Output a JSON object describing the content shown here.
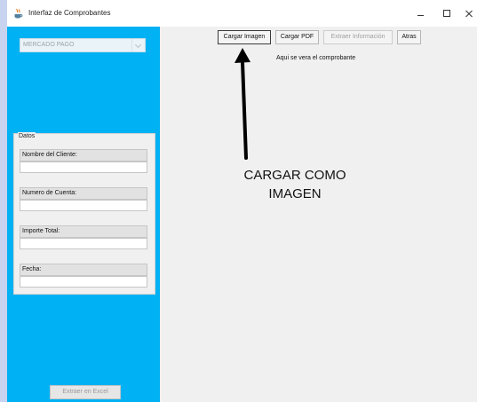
{
  "window": {
    "title": "Interfaz de Comprobantes",
    "controls": [
      "minimize",
      "maximize",
      "close"
    ]
  },
  "sidebar": {
    "provider_select": {
      "value": "MERCADO PAGO"
    },
    "datos": {
      "legend": "Datos",
      "fields": [
        {
          "label": "Nombre del Cliente:",
          "value": ""
        },
        {
          "label": "Numero de Cuenta:",
          "value": ""
        },
        {
          "label": "Importe Total:",
          "value": ""
        },
        {
          "label": "Fecha:",
          "value": ""
        }
      ]
    },
    "export_button": "Extraer en Excel"
  },
  "toolbar": {
    "buttons": [
      {
        "label": "Cargar Imagen",
        "state": "focused"
      },
      {
        "label": "Cargar PDF",
        "state": "enabled"
      },
      {
        "label": "Extraer Información",
        "state": "disabled"
      },
      {
        "label": "Atras",
        "state": "enabled"
      }
    ]
  },
  "preview": {
    "placeholder": "Aqui se vera el comprobante"
  },
  "annotation": {
    "line1": "CARGAR COMO",
    "line2": "IMAGEN"
  },
  "colors": {
    "sidebar_bg": "#00b1f3",
    "window_bg": "#f0f0f0",
    "page_bg": "#c8d3f0"
  }
}
